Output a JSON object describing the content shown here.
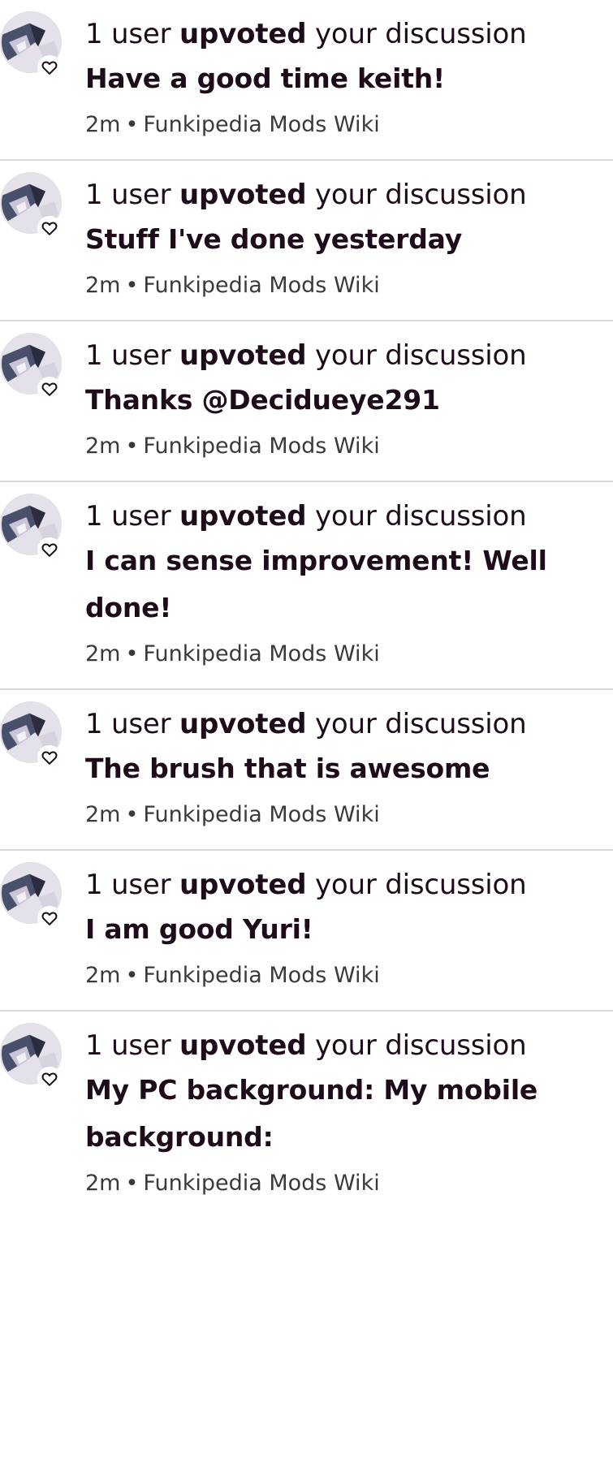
{
  "notifications": [
    {
      "count_text": "1 user",
      "verb": "upvoted",
      "tail": "your discussion",
      "title": "Have a good time keith!",
      "time": "2m",
      "separator": "•",
      "wiki": "Funkipedia Mods Wiki"
    },
    {
      "count_text": "1 user",
      "verb": "upvoted",
      "tail": "your discussion",
      "title": "Stuff I've done yesterday",
      "time": "2m",
      "separator": "•",
      "wiki": "Funkipedia Mods Wiki"
    },
    {
      "count_text": "1 user",
      "verb": "upvoted",
      "tail": "your discussion",
      "title": "Thanks @Decidueye291",
      "time": "2m",
      "separator": "•",
      "wiki": "Funkipedia Mods Wiki"
    },
    {
      "count_text": "1 user",
      "verb": "upvoted",
      "tail": "your discussion",
      "title": "I can sense improvement! Well done!",
      "time": "2m",
      "separator": "•",
      "wiki": "Funkipedia Mods Wiki"
    },
    {
      "count_text": "1 user",
      "verb": "upvoted",
      "tail": "your discussion",
      "title": "The brush that is awesome",
      "time": "2m",
      "separator": "•",
      "wiki": "Funkipedia Mods Wiki"
    },
    {
      "count_text": "1 user",
      "verb": "upvoted",
      "tail": "your discussion",
      "title": "I am good Yuri!",
      "time": "2m",
      "separator": "•",
      "wiki": "Funkipedia Mods Wiki"
    },
    {
      "count_text": "1 user",
      "verb": "upvoted",
      "tail": "your discussion",
      "title": "My PC background: My mobile background:",
      "time": "2m",
      "separator": "•",
      "wiki": "Funkipedia Mods Wiki"
    }
  ],
  "icons": {
    "avatar": "user-avatar-image",
    "badge": "heart-icon"
  },
  "colors": {
    "text": "#1e0c1b",
    "meta": "#3a3a3a",
    "divider": "#d8d8d8"
  }
}
